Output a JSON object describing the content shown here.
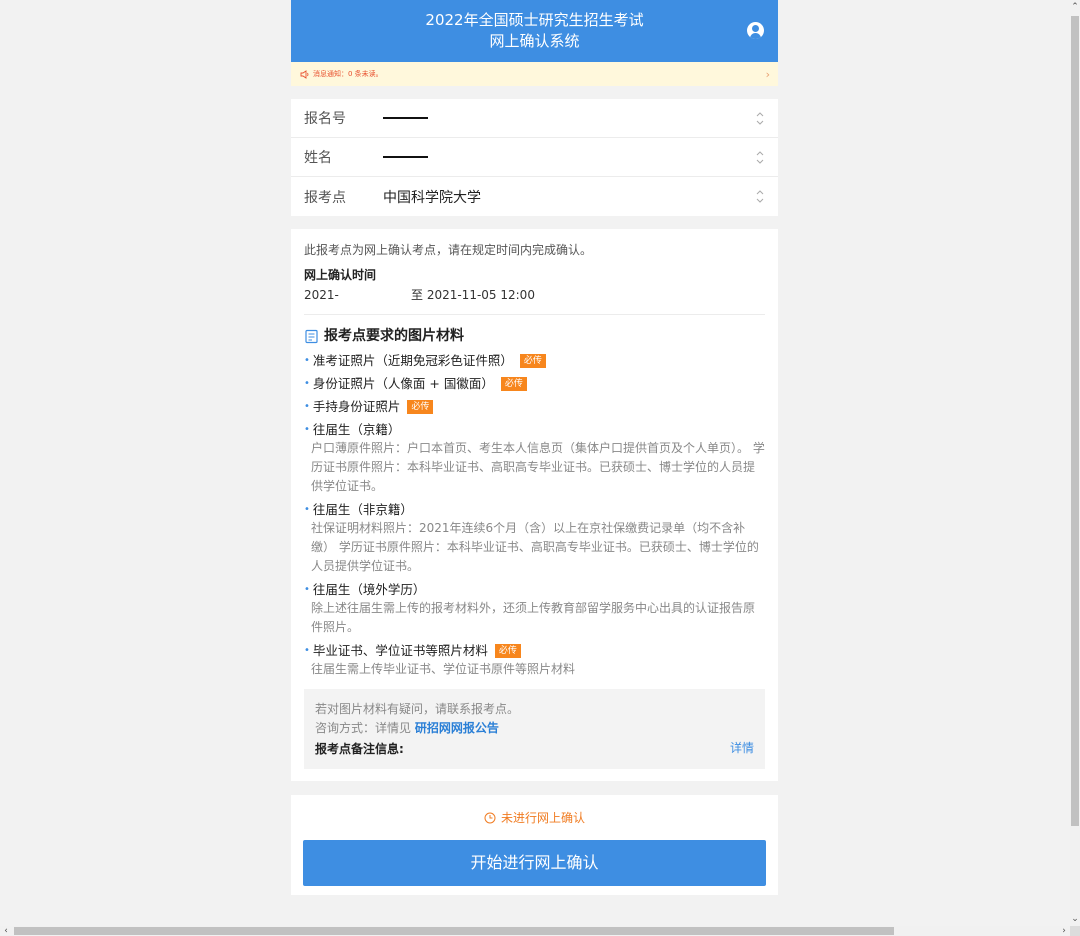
{
  "header": {
    "title_line1": "2022年全国硕士研究生招生考试",
    "title_line2": "网上确认系统"
  },
  "notice": {
    "text": "消息通知：0 条未读。"
  },
  "form": {
    "rows": [
      {
        "label": "报名号",
        "value": ""
      },
      {
        "label": "姓名",
        "value": ""
      },
      {
        "label": "报考点",
        "value": "中国科学院大学"
      }
    ]
  },
  "info": {
    "note": "此报考点为网上确认考点，请在规定时间内完成确认。",
    "time_title": "网上确认时间",
    "time_start": "2021-",
    "time_end": "至 2021-11-05 12:00",
    "section_title": "报考点要求的图片材料",
    "badge_label": "必传",
    "materials": [
      {
        "title": "准考证照片（近期免冠彩色证件照）",
        "required": true,
        "desc": ""
      },
      {
        "title": "身份证照片（人像面 + 国徽面）",
        "required": true,
        "desc": ""
      },
      {
        "title": "手持身份证照片",
        "required": true,
        "desc": ""
      },
      {
        "title": "往届生（京籍）",
        "required": false,
        "desc": "户口薄原件照片：户口本首页、考生本人信息页（集体户口提供首页及个人单页）。 学历证书原件照片：本科毕业证书、高职高专毕业证书。已获硕士、博士学位的人员提供学位证书。"
      },
      {
        "title": "往届生（非京籍）",
        "required": false,
        "desc": "社保证明材料照片：2021年连续6个月（含）以上在京社保缴费记录单（均不含补缴） 学历证书原件照片：本科毕业证书、高职高专毕业证书。已获硕士、博士学位的人员提供学位证书。"
      },
      {
        "title": "往届生（境外学历）",
        "required": false,
        "desc": "除上述往届生需上传的报考材料外，还须上传教育部留学服务中心出具的认证报告原件照片。"
      },
      {
        "title": "毕业证书、学位证书等照片材料",
        "required": true,
        "desc": "往届生需上传毕业证书、学位证书原件等照片材料"
      }
    ],
    "contact": {
      "help": "若对图片材料有疑问，请联系报考点。",
      "consult_prefix": "咨询方式：详情见 ",
      "consult_link": "研招网网报公告",
      "remark_label": "报考点备注信息:",
      "detail_label": "详情"
    }
  },
  "action": {
    "status": "未进行网上确认",
    "button_label": "开始进行网上确认"
  },
  "colors": {
    "primary": "#3e8ee2",
    "badge": "#f7861d",
    "notice_bg": "#fff8dc",
    "notice_text": "#e8502e",
    "status": "#f07c22"
  },
  "icons": {
    "user": "user-circle-icon",
    "notice": "speaker-icon",
    "notice_arrow": "chevron-right-icon",
    "select": "updown-chevron-icon",
    "section": "document-icon",
    "status": "clock-icon"
  }
}
